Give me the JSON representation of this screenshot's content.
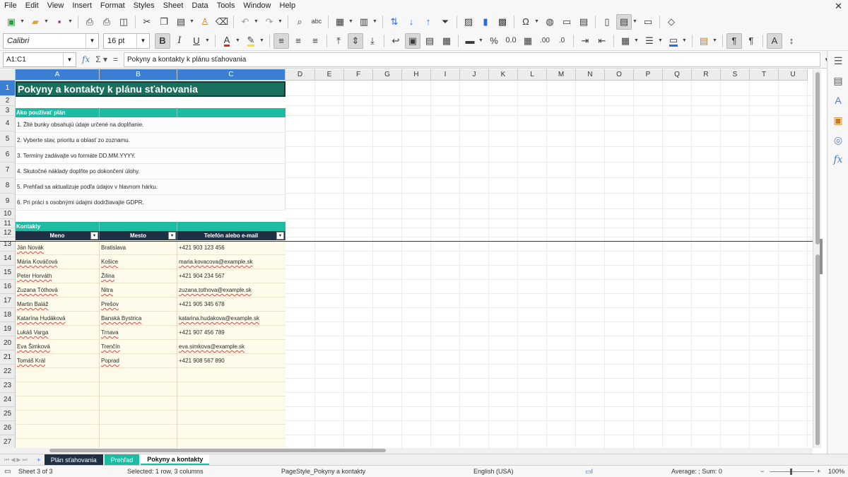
{
  "menu": [
    "File",
    "Edit",
    "View",
    "Insert",
    "Format",
    "Styles",
    "Sheet",
    "Data",
    "Tools",
    "Window",
    "Help"
  ],
  "font": {
    "name": "Calibri",
    "size": "16 pt"
  },
  "formula_bar": {
    "name_box": "A1:C1",
    "content": "Pokyny a kontakty k plánu sťahovania"
  },
  "columns": [
    "A",
    "B",
    "C",
    "D",
    "E",
    "F",
    "G",
    "H",
    "I",
    "J",
    "K",
    "L",
    "M",
    "N",
    "O",
    "P",
    "Q",
    "R",
    "S",
    "T",
    "U"
  ],
  "rows": [
    "1",
    "2",
    "3",
    "4",
    "5",
    "6",
    "7",
    "8",
    "9",
    "10",
    "11",
    "12",
    "13",
    "14",
    "15",
    "16",
    "17",
    "18",
    "19",
    "20",
    "21",
    "22",
    "23",
    "24",
    "25",
    "26",
    "27"
  ],
  "sheet": {
    "title": "Pokyny a kontakty k plánu sťahovania",
    "instructions_header": "Ako používať plán",
    "instructions": [
      "1. Žlté bunky obsahujú údaje určené na dopĺňanie.",
      "2. Vyberte stav, prioritu a oblasť zo zoznamu.",
      "3. Termíny zadávajte vo formáte DD.MM.YYYY.",
      "4. Skutočné náklady doplňte po dokončení úlohy.",
      "5. Prehľad sa aktualizuje podľa údajov v hlavnom hárku.",
      "6. Pri práci s osobnými údajmi dodržiavajte GDPR."
    ],
    "contacts_header": "Kontakty",
    "table_headers": [
      "Meno",
      "Mesto",
      "Telefón alebo e-mail"
    ],
    "contacts": [
      {
        "name": "Ján Novák",
        "city": "Bratislava",
        "contact": "+421 903 123 456"
      },
      {
        "name": "Mária Kováčová",
        "city": "Košice",
        "contact": "maria.kovacova@example.sk"
      },
      {
        "name": "Peter Horváth",
        "city": "Žilina",
        "contact": "+421 904 234 567"
      },
      {
        "name": "Zuzana Tóthová",
        "city": "Nitra",
        "contact": "zuzana.tothova@example.sk"
      },
      {
        "name": "Martin Baláž",
        "city": "Prešov",
        "contact": "+421 905 345 678"
      },
      {
        "name": "Katarína Hudáková",
        "city": "Banská Bystrica",
        "contact": "katarina.hudakova@example.sk"
      },
      {
        "name": "Lukáš Varga",
        "city": "Trnava",
        "contact": "+421 907 456 789"
      },
      {
        "name": "Eva Šimková",
        "city": "Trenčín",
        "contact": "eva.simkova@example.sk"
      },
      {
        "name": "Tomáš Král",
        "city": "Poprad",
        "contact": "+421 908 567 890"
      }
    ]
  },
  "tabs": [
    "Plán sťahovania",
    "Prehľad",
    "Pokyny a kontakty"
  ],
  "status": {
    "sheet": "Sheet 3 of 3",
    "selection": "Selected: 1 row, 3 columns",
    "page_style": "PageStyle_Pokyny a kontakty",
    "language": "English (USA)",
    "summary": "Average: ; Sum: 0",
    "zoom": "100%"
  },
  "colors": {
    "title_band": "#19705f",
    "section_band": "#1dbba1",
    "table_header": "#1f3045",
    "input_fill": "#fefbea",
    "selection": "#3b7fd4"
  }
}
